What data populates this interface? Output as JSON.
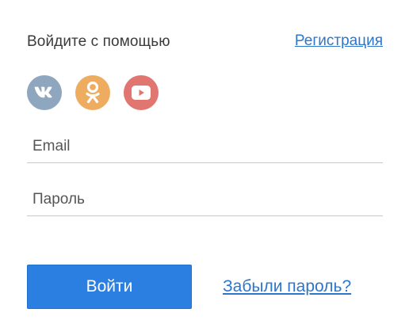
{
  "header": {
    "login_with_label": "Войдите с помощью",
    "register_link": "Регистрация"
  },
  "social": [
    {
      "icon": "vk-icon",
      "color": "#8fa6bf"
    },
    {
      "icon": "odnoklassniki-icon",
      "color": "#eeac60"
    },
    {
      "icon": "youtube-icon",
      "color": "#e17570"
    }
  ],
  "form": {
    "email_placeholder": "Email",
    "email_value": "",
    "password_placeholder": "Пароль",
    "password_value": "",
    "submit_label": "Войти",
    "forgot_link": "Забыли пароль?"
  },
  "colors": {
    "accent": "#2b7fe0",
    "link": "#2e76c9"
  }
}
